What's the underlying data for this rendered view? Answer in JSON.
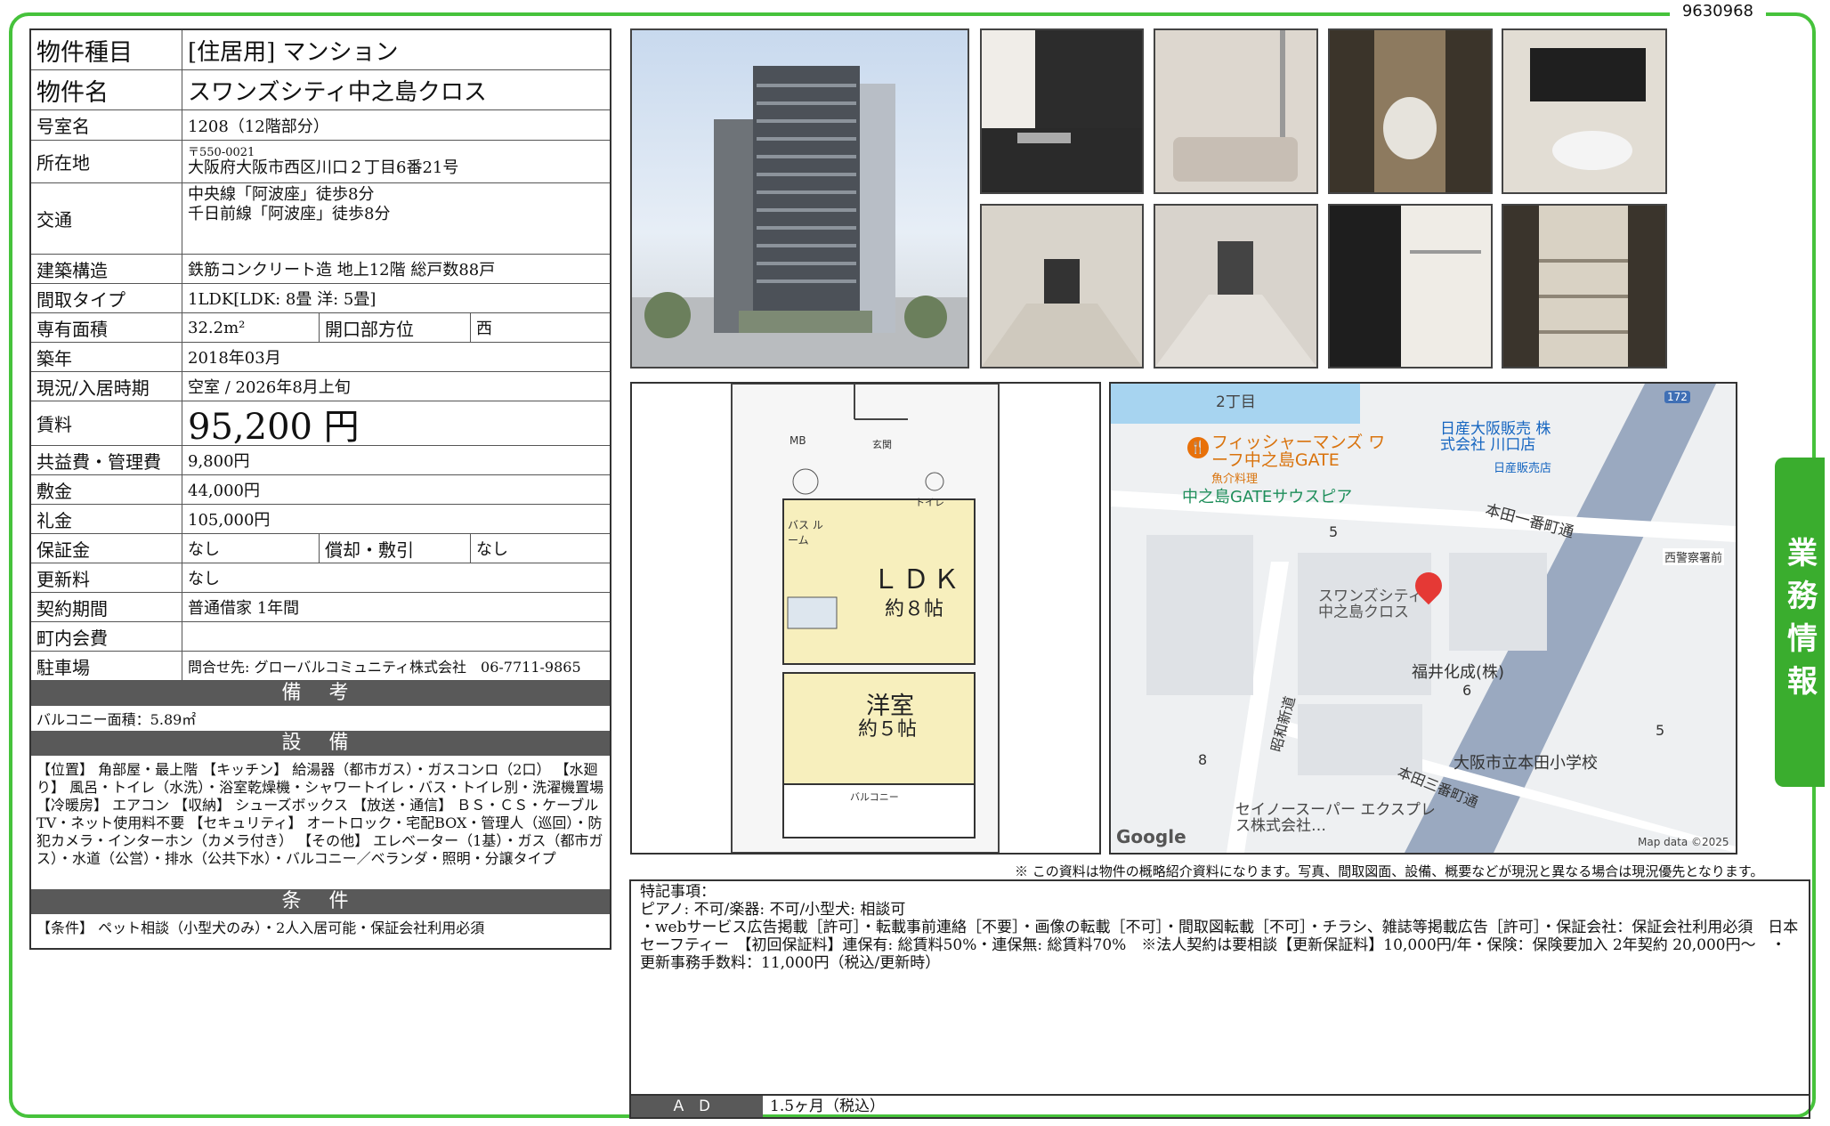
{
  "doc_id": "9630968",
  "side_tab": "業務情報",
  "rows": {
    "type": {
      "label": "物件種目",
      "value": "[住居用] マンション"
    },
    "name": {
      "label": "物件名",
      "value": "スワンズシティ中之島クロス"
    },
    "room": {
      "label": "号室名",
      "value": "1208（12階部分）"
    },
    "address": {
      "label": "所在地",
      "postal": "〒550-0021",
      "value": "大阪府大阪市西区川口２丁目6番21号"
    },
    "access": {
      "label": "交通",
      "line1": "中央線「阿波座」徒歩8分",
      "line2": "千日前線「阿波座」徒歩8分"
    },
    "structure": {
      "label": "建築構造",
      "value": "鉄筋コンクリート造 地上12階 総戸数88戸"
    },
    "layout": {
      "label": "間取タイプ",
      "value": "1LDK[LDK: 8畳 洋: 5畳]"
    },
    "area": {
      "label": "専有面積",
      "value": "32.2m²",
      "label2": "開口部方位",
      "value2": "西"
    },
    "built": {
      "label": "築年",
      "value": "2018年03月"
    },
    "status": {
      "label": "現況/入居時期",
      "value": "空室 / 2026年8月上旬"
    },
    "rent": {
      "label": "賃料",
      "value": "95,200 円"
    },
    "fee": {
      "label": "共益費・管理費",
      "value": "9,800円"
    },
    "deposit": {
      "label": "敷金",
      "value": "44,000円"
    },
    "key_money": {
      "label": "礼金",
      "value": "105,000円"
    },
    "guarantee": {
      "label": "保証金",
      "value": "なし",
      "label2": "償却・敷引",
      "value2": "なし"
    },
    "renewal": {
      "label": "更新料",
      "value": "なし"
    },
    "contract": {
      "label": "契約期間",
      "value": "普通借家 1年間"
    },
    "town": {
      "label": "町内会費",
      "value": ""
    },
    "parking": {
      "label": "駐車場",
      "value": "問合せ先: グローバルコミュニティ株式会社　06-7711-9865"
    }
  },
  "remarks": {
    "title": "備 考",
    "text": "バルコニー面積：5.89㎡"
  },
  "facilities": {
    "title": "設 備",
    "text": "【位置】 角部屋・最上階 【キッチン】 給湯器（都市ガス）・ガスコンロ（2口） 【水廻り】 風呂・トイレ（水洗）・浴室乾燥機・シャワートイレ・バス・トイレ別・洗濯機置場 【冷暖房】 エアコン 【収納】 シューズボックス 【放送・通信】 ＢＳ・ＣＳ・ケーブルTV・ネット使用料不要 【セキュリティ】 オートロック・宅配BOX・管理人（巡回）・防犯カメラ・インターホン（カメラ付き） 【その他】 エレベーター（1基）・ガス（都市ガス）・水道（公営）・排水（公共下水）・バルコニー／ベランダ・照明・分譲タイプ"
  },
  "conditions": {
    "title": "条 件",
    "text": "【条件】 ペット相談（小型犬のみ）・2人入居可能・保証会社利用必須"
  },
  "plan_labels": {
    "ldk": "ＬＤＫ",
    "ldk_size": "約８帖",
    "western": "洋室",
    "western_size": "約５帖",
    "mb": "MB",
    "entrance": "玄関",
    "bath": "バス ルーム",
    "toilet": "トイレ",
    "balcony": "バルコニー"
  },
  "map": {
    "block": "2丁目",
    "poi1": "フィッシャーマンズ ワーフ中之島GATE",
    "poi1_sub": "魚介料理",
    "poi2": "中之島GATEサウスピア",
    "poi3": "日産大阪販売 株式会社 川口店",
    "poi3_sub": "日産販売店",
    "road1": "本田一番町通",
    "police": "西警察署前",
    "pin": "スワンズシティ 中之島クロス",
    "poi4": "福井化成(株)",
    "road2": "昭和新道",
    "road3": "本田三番町通",
    "school": "大阪市立本田小学校",
    "poi5": "セイノースーパー エクスプレス株式会社…",
    "num5a": "5",
    "num6": "6",
    "num8": "8",
    "num5b": "5",
    "route": "172",
    "google": "Google",
    "credit": "Map data ©2025"
  },
  "notice": "※ この資料は物件の概略紹介資料になります。写真、間取図面、設備、概要などが現況と異なる場合は現況優先となります。",
  "special": {
    "title": "特記事項：",
    "line1": "ピアノ: 不可/楽器: 不可/小型犬: 相談可",
    "line2": "・webサービス広告掲載［許可］・転載事前連絡［不要］・画像の転載［不可］・間取図転載［不可］・チラシ、雑誌等掲載広告［許可］・保証会社：保証会社利用必須　日本セーフティー　【初回保証料】連保有: 総賃料50%・連保無: 総賃料70%　※法人契約は要相談【更新保証料】10,000円/年・保険：保険要加入 2年契約 20,000円～　・更新事務手数料：11,000円（税込/更新時）"
  },
  "ad": {
    "label": "ＡＤ",
    "value": "1.5ヶ月（税込）"
  },
  "colors": {
    "green": "#46c23b",
    "header": "#595959",
    "pin": "#e53935"
  }
}
